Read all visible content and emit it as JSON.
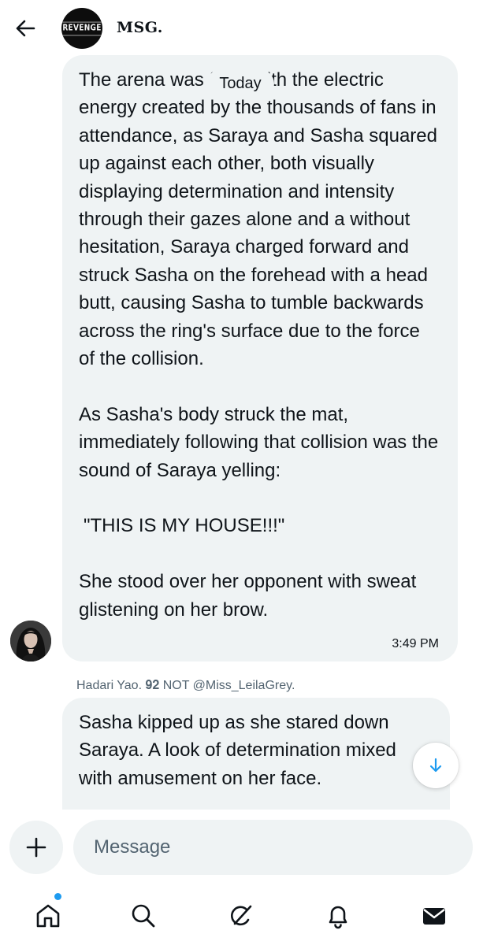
{
  "header": {
    "title": "MSG.",
    "avatar_logo_text": "REVENGE",
    "back_icon": "arrow-left-icon"
  },
  "conversation": {
    "day_separator": "Today",
    "messages": [
      {
        "paragraphs": [
          "The arena was filled with the electric energy created by the thousands of fans in attendance, as Saraya and Sasha squared up against each other, both visually displaying determination and intensity through their gazes alone and a without hesitation, Saraya charged forward and struck Sasha on the forehead with a head butt, causing Sasha to tumble backwards across the ring's surface due to the force of the collision.",
          "As Sasha's body struck the mat, immediately following that collision was the sound of Saraya yelling:",
          "\"THIS IS MY HOUSE!!!\"",
          "She stood over her opponent with sweat glistening on her brow."
        ],
        "time": "3:49 PM"
      },
      {
        "sender": "Hadari Yao. 𝟗𝟐 NOT @Miss_LeilaGrey.",
        "text": "Sasha kipped up as she stared down Saraya. A look of determination mixed with amusement on her face."
      }
    ]
  },
  "composer": {
    "placeholder": "Message",
    "add_icon": "plus-icon"
  },
  "tabbar": {
    "items": [
      {
        "icon": "home-icon",
        "has_notification": true
      },
      {
        "icon": "search-icon"
      },
      {
        "icon": "grok-icon"
      },
      {
        "icon": "bell-icon"
      },
      {
        "icon": "mail-icon"
      }
    ]
  },
  "colors": {
    "bubble": "#eff3f4",
    "text": "#0f1419",
    "secondary_text": "#536471",
    "accent": "#1d9bf0"
  }
}
